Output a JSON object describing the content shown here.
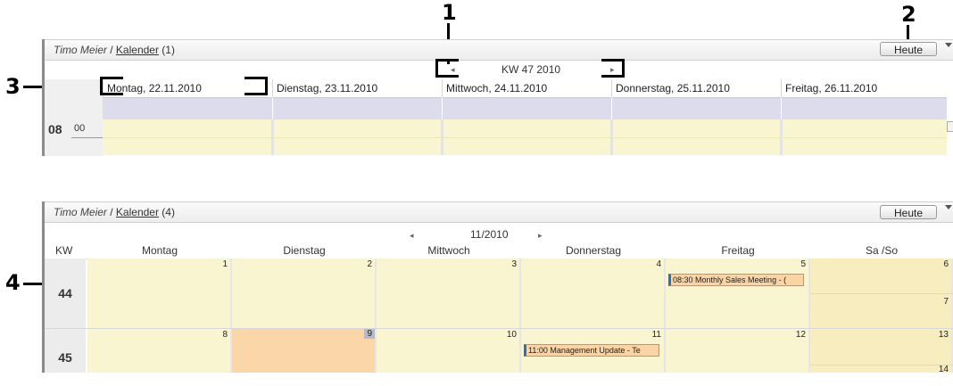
{
  "callouts": {
    "one": "1",
    "two": "2",
    "three": "3",
    "four": "4"
  },
  "week_panel": {
    "owner": "Timo Meier",
    "separator": " / ",
    "calendar_link": "Kalender",
    "count": " (1)",
    "today_button": "Heute",
    "week_label": "KW 47 2010",
    "prev_arrow": "◂",
    "next_arrow": "▸",
    "days": [
      "Montag, 22.11.2010",
      "Dienstag, 23.11.2010",
      "Mittwoch, 24.11.2010",
      "Donnerstag, 25.11.2010",
      "Freitag, 26.11.2010"
    ],
    "hour": "08",
    "minute": "00"
  },
  "month_panel": {
    "owner": "Timo Meier",
    "separator": " / ",
    "calendar_link": "Kalender",
    "count": " (4)",
    "today_button": "Heute",
    "month_label": "11/2010",
    "prev_arrow": "◂",
    "next_arrow": "▸",
    "kw_header": "KW",
    "weekdays": [
      "Montag",
      "Dienstag",
      "Mittwoch",
      "Donnerstag",
      "Freitag",
      "Sa /So"
    ],
    "weeks": [
      {
        "kw": "44",
        "days": [
          "1",
          "2",
          "3",
          "4",
          "5"
        ],
        "sat": "6",
        "sun": "7"
      },
      {
        "kw": "45",
        "days": [
          "8",
          "9",
          "10",
          "11",
          "12"
        ],
        "sat": "13",
        "sun": "14"
      }
    ],
    "events": {
      "friday_5": "08:30 Monthly Sales Meeting - (",
      "thursday_11": "11:00 Management Update - Te"
    }
  },
  "colors": {
    "cell": "#f9f5d0",
    "today": "#fbd6a8",
    "event": "#fbd4a5",
    "event_accent": "#2d6fb7",
    "allday": "#dcdcec"
  }
}
